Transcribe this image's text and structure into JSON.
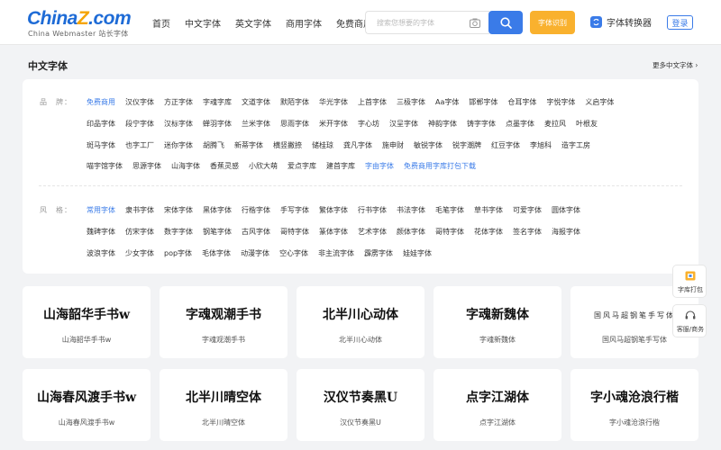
{
  "header": {
    "logo_main": "China",
    "logo_z": "Z",
    "logo_dot": ".com",
    "logo_sub": "China Webmaster 站长字体",
    "nav": [
      "首页",
      "中文字体",
      "英文字体",
      "商用字体",
      "免费商用"
    ],
    "search_placeholder": "搜索您想要的字体",
    "shibie_label": "字体识别",
    "converter_label": "字体转换器",
    "login_label": "登录"
  },
  "section": {
    "title": "中文字体",
    "more": "更多中文字体 ›"
  },
  "filters": {
    "brand_label": "品　牌：",
    "brand_rows": [
      [
        "免费商用",
        "汉仪字体",
        "方正字体",
        "字魂字库",
        "文道字体",
        "默陌字体",
        "华光字体",
        "上首字体",
        "三极字体",
        "Aa字体",
        "邯郸字体",
        "仓耳字体",
        "字悦字体",
        "义启字体"
      ],
      [
        "印品字体",
        "段宁字体",
        "汉标字体",
        "蝉羽字体",
        "兰米字体",
        "思雨字体",
        "米开字体",
        "字心坊",
        "汉呈字体",
        "神韵字体",
        "铸字字体",
        "点墨字体",
        "麦拉风",
        "叶根友"
      ],
      [
        "斑马字体",
        "也字工厂",
        "迷你字体",
        "胡腾飞",
        "新蒂字体",
        "横竖撇捺",
        "储桂琼",
        "龚凡字体",
        "施申财",
        "敏锐字体",
        "锐字潮牌",
        "红豆字体",
        "李旭科",
        "造字工房"
      ],
      [
        "喵宇馆字体",
        "思源字体",
        "山海字体",
        "香蕉灵感",
        "小欣大萌",
        "爱点字库",
        "建首字库",
        "字由字体",
        "免费商用字库打包下载"
      ]
    ],
    "style_label": "风　格：",
    "style_rows": [
      [
        "常用字体",
        "隶书字体",
        "宋体字体",
        "黑体字体",
        "行楷字体",
        "手写字体",
        "繁体字体",
        "行书字体",
        "书法字体",
        "毛笔字体",
        "草书字体",
        "可爱字体",
        "圆体字体"
      ],
      [
        "魏碑字体",
        "仿宋字体",
        "数字字体",
        "钢笔字体",
        "古风字体",
        "哥特字体",
        "篆体字体",
        "艺术字体",
        "颜体字体",
        "哥特字体",
        "花体字体",
        "签名字体",
        "海报字体"
      ],
      [
        "波浪字体",
        "少女字体",
        "pop字体",
        "毛体字体",
        "动漫字体",
        "空心字体",
        "非主流字体",
        "霹雳字体",
        "娃娃字体"
      ]
    ]
  },
  "cards": [
    {
      "preview": "山海韶华手书w",
      "name": "山海韶华手书w"
    },
    {
      "preview": "字魂观潮手书",
      "name": "字魂观潮手书"
    },
    {
      "preview": "北半川心动体",
      "name": "北半川心动体"
    },
    {
      "preview": "字魂新魏体",
      "name": "字魂新魏体"
    },
    {
      "preview": "国风马超钢笔手写体",
      "name": "国风马超钢笔手写体"
    },
    {
      "preview": "山海春风渡手书w",
      "name": "山海春风渡手书w"
    },
    {
      "preview": "北半川晴空体",
      "name": "北半川晴空体"
    },
    {
      "preview": "汉仪节奏黑U",
      "name": "汉仪节奏黑U"
    },
    {
      "preview": "点字江湖体",
      "name": "点字江湖体"
    },
    {
      "preview": "字小魂沧浪行楷",
      "name": "字小魂沧浪行楷"
    }
  ],
  "float": {
    "pack_label": "字库打包",
    "service_label": "客服/商务"
  },
  "colors": {
    "brand_blue": "#3a7be8",
    "accent_orange": "#f9b12e",
    "logo_z": "#f5a400"
  }
}
